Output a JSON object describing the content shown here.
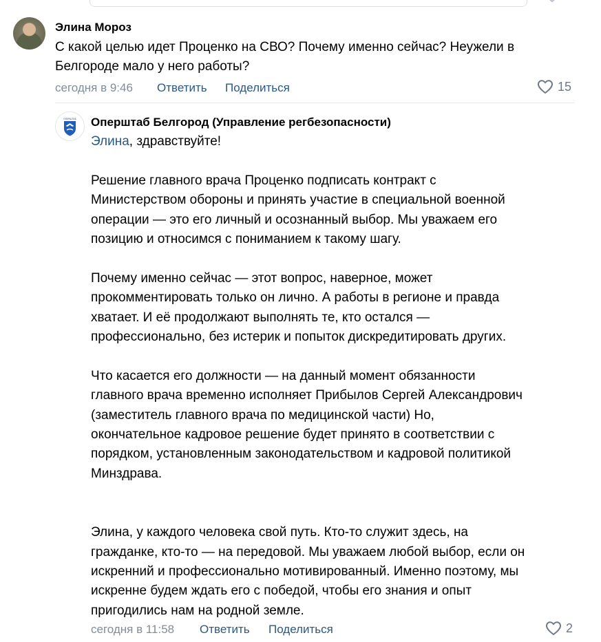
{
  "comment1": {
    "author": "Элина Мороз",
    "text": "С какой целью идет Проценко на СВО? Почему именно сейчас? Неужели в\nБелгороде мало у него работы?",
    "time": "сегодня в 9:46",
    "reply_label": "Ответить",
    "share_label": "Поделиться",
    "likes": "15"
  },
  "comment2": {
    "author": "Оперштаб Белгород (Управление регбезопасности)",
    "mention": "Элина",
    "greeting_rest": ", здравствуйте!",
    "body": "Решение главного врача Проценко подписать контракт с\nМинистерством обороны и принять участие в специальной военной\nоперации — это его личный и осознанный выбор. Мы уважаем его\nпозицию и относимся с пониманием к такому шагу.\n\nПочему именно сейчас — этот вопрос, наверное, может\nпрокомментировать только он лично. А работы в регионе и правда\nхватает. И её продолжают выполнять те, кто остался —\nпрофессионально, без истерик и попыток дискредитировать других.\n\nЧто касается его должности — на данный момент обязанности\nглавного врача временно исполняет Прибылов Сергей Александрович\n(заместитель главного врача по медицинской части) Но,\nокончательное кадровое решение будет принято в соответствии с\nпорядком, установленным законодательством и кадровой политикой\nМинздрава.\n\n\nЭлина, у каждого человека свой путь. Кто-то служит здесь, на\nгражданке, кто-то — на передовой. Мы уважаем любой выбор, если он\nискренний и профессионально мотивированный. Именно поэтому, мы\nискренне будем ждать его с победой, чтобы его знания и опыт\nпригодились нам на родной земле.",
    "time": "сегодня в 11:58",
    "reply_label": "Ответить",
    "share_label": "Поделиться",
    "likes": "2"
  },
  "colors": {
    "link": "#2a5885",
    "meta": "#818c99",
    "divider": "#e7e8ec"
  }
}
